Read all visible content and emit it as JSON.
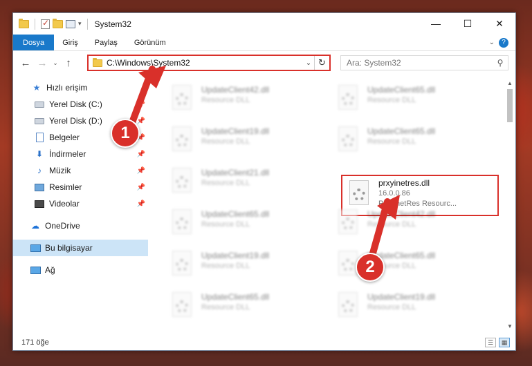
{
  "window": {
    "title": "System32",
    "controls": {
      "minimize": "—",
      "maximize": "☐",
      "close": "✕"
    }
  },
  "ribbon": {
    "tabs": [
      {
        "label": "Dosya",
        "active": true
      },
      {
        "label": "Giriş",
        "active": false
      },
      {
        "label": "Paylaş",
        "active": false
      },
      {
        "label": "Görünüm",
        "active": false
      }
    ]
  },
  "nav": {
    "back": "←",
    "forward": "→",
    "recent": "⌄",
    "up": "↑",
    "address": "C:\\Windows\\System32",
    "address_dropdown": "⌄",
    "refresh": "↻",
    "search_placeholder": "Ara: System32",
    "search_icon": "search-icon"
  },
  "sidebar": {
    "items": [
      {
        "label": "Hızlı erişim",
        "icon": "star-icon",
        "pinned": false
      },
      {
        "label": "Yerel Disk (C:)",
        "icon": "disk-icon",
        "pinned": true
      },
      {
        "label": "Yerel Disk (D:)",
        "icon": "disk-icon",
        "pinned": true
      },
      {
        "label": "Belgeler",
        "icon": "document-icon",
        "pinned": true
      },
      {
        "label": "İndirmeler",
        "icon": "download-icon",
        "pinned": true
      },
      {
        "label": "Müzik",
        "icon": "music-icon",
        "pinned": true
      },
      {
        "label": "Resimler",
        "icon": "pictures-icon",
        "pinned": true
      },
      {
        "label": "Videolar",
        "icon": "videos-icon",
        "pinned": true
      },
      {
        "label": "OneDrive",
        "icon": "cloud-icon",
        "pinned": false
      },
      {
        "label": "Bu bilgisayar",
        "icon": "computer-icon",
        "pinned": false,
        "selected": true
      },
      {
        "label": "Ağ",
        "icon": "network-icon",
        "pinned": false
      }
    ]
  },
  "files": {
    "left_column": [
      {
        "name": "UpdateClient42.dll",
        "type": "Resource DLL"
      },
      {
        "name": "UpdateClient19.dll",
        "type": "Resource DLL"
      },
      {
        "name": "UpdateClient21.dll",
        "type": "Resource DLL"
      },
      {
        "name": "UpdateClient65.dll",
        "type": "Resource DLL"
      },
      {
        "name": "UpdateClient19.dll",
        "type": "Resource DLL"
      },
      {
        "name": "UpdateClient65.dll",
        "type": "Resource DLL"
      }
    ],
    "right_column": [
      {
        "name": "UpdateClient65.dll",
        "type": "Resource DLL"
      },
      {
        "name": "UpdateClient65.dll",
        "type": "Resource DLL"
      },
      {
        "name": "prxyinetres.dll",
        "type": "16.0.0.86",
        "desc": "PrxyInetRes Resourc...",
        "highlighted": true
      },
      {
        "name": "UpdateClient42.dll",
        "type": "Resource DLL"
      },
      {
        "name": "UpdateClient65.dll",
        "type": "Resource DLL"
      },
      {
        "name": "UpdateClient19.dll",
        "type": "Resource DLL"
      }
    ]
  },
  "status": {
    "count": "171 öğe"
  },
  "annotations": {
    "step1": "1",
    "step2": "2",
    "color": "#d9302a"
  }
}
